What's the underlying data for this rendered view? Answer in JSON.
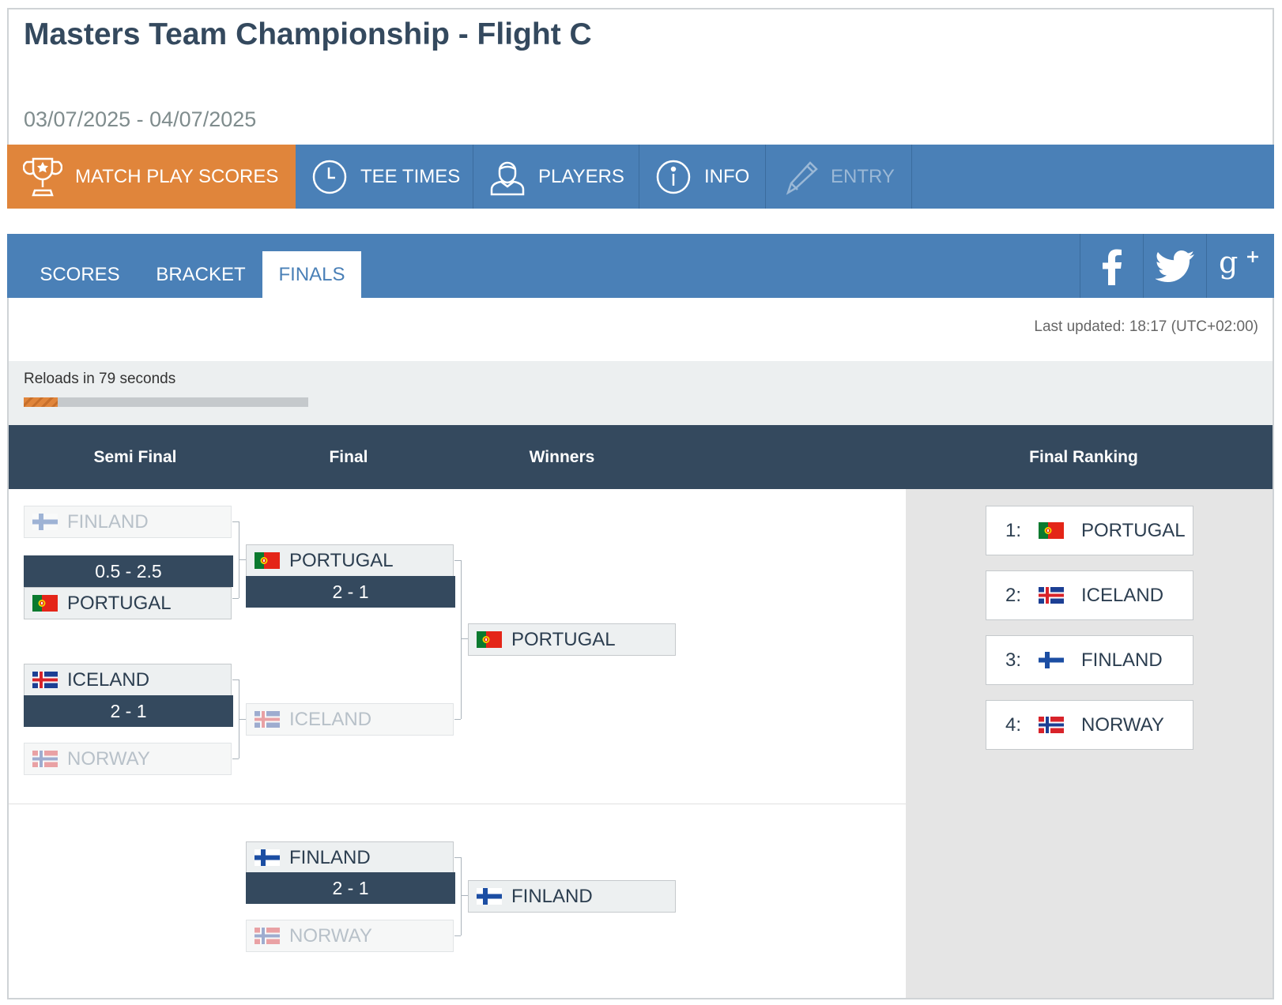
{
  "header": {
    "title": "Masters Team Championship - Flight C",
    "dates": "03/07/2025 - 04/07/2025"
  },
  "nav": {
    "items": [
      {
        "label": "MATCH PLAY SCORES",
        "icon": "trophy-icon",
        "active": true
      },
      {
        "label": "TEE TIMES",
        "icon": "clock-icon"
      },
      {
        "label": "PLAYERS",
        "icon": "person-icon"
      },
      {
        "label": "INFO",
        "icon": "info-icon"
      },
      {
        "label": "ENTRY",
        "icon": "pencil-icon",
        "disabled": true
      }
    ]
  },
  "tabs": {
    "items": [
      {
        "label": "SCORES"
      },
      {
        "label": "BRACKET"
      },
      {
        "label": "FINALS",
        "active": true
      }
    ],
    "social": [
      "facebook-icon",
      "twitter-icon",
      "google-plus-icon"
    ]
  },
  "status": {
    "last_updated": "Last updated: 18:17 (UTC+02:00)",
    "reload_text": "Reloads in 79 seconds",
    "reload_progress": 0.12
  },
  "columns": {
    "semi_final": "Semi Final",
    "final": "Final",
    "winners": "Winners",
    "final_ranking": "Final Ranking"
  },
  "bracket": {
    "semi1": {
      "team_a": "FINLAND",
      "score": "0.5 - 2.5",
      "team_b": "PORTUGAL"
    },
    "semi2": {
      "team_a": "ICELAND",
      "score": "2 - 1",
      "team_b": "NORWAY"
    },
    "final": {
      "team_a": "PORTUGAL",
      "score": "2 - 1",
      "team_b": "ICELAND"
    },
    "winner": "PORTUGAL",
    "third_place": {
      "team_a": "FINLAND",
      "score": "2 - 1",
      "team_b": "NORWAY"
    },
    "third_winner": "FINLAND"
  },
  "ranking": [
    {
      "pos": "1:",
      "team": "PORTUGAL"
    },
    {
      "pos": "2:",
      "team": "ICELAND"
    },
    {
      "pos": "3:",
      "team": "FINLAND"
    },
    {
      "pos": "4:",
      "team": "NORWAY"
    }
  ],
  "colors": {
    "nav_blue": "#4a80b7",
    "active_orange": "#e0853b",
    "dark_navy": "#34495e"
  }
}
